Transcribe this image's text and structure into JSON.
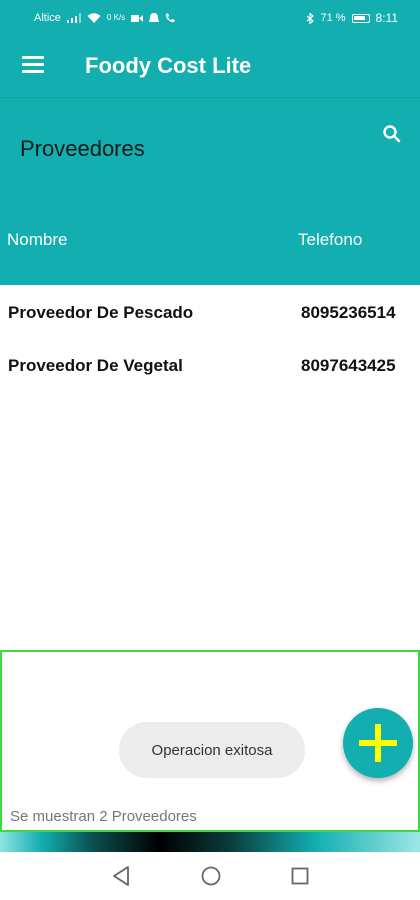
{
  "status_bar": {
    "carrier": "Altice",
    "data_rate": "0 K/s",
    "battery": "71 %",
    "time": "8:11"
  },
  "app_bar": {
    "title": "Foody Cost Lite"
  },
  "section": {
    "title": "Proveedores",
    "columns": [
      "Nombre",
      "Telefono"
    ]
  },
  "proveedores": [
    {
      "nombre": "Proveedor De Pescado",
      "telefono": "8095236514"
    },
    {
      "nombre": "Proveedor De Vegetal",
      "telefono": "8097643425"
    }
  ],
  "toast": {
    "message": "Operacion exitosa"
  },
  "footer": {
    "count_text": "Se muestran 2 Proveedores"
  },
  "icons": {
    "menu": "hamburger-menu-icon",
    "search": "search-icon",
    "fab": "plus-icon",
    "nav": [
      "back-triangle-icon",
      "home-circle-icon",
      "recents-square-icon"
    ]
  },
  "colors": {
    "primary": "#12aeb0",
    "fab_plus": "#ffff00",
    "panel_border": "#3ddc3d"
  }
}
